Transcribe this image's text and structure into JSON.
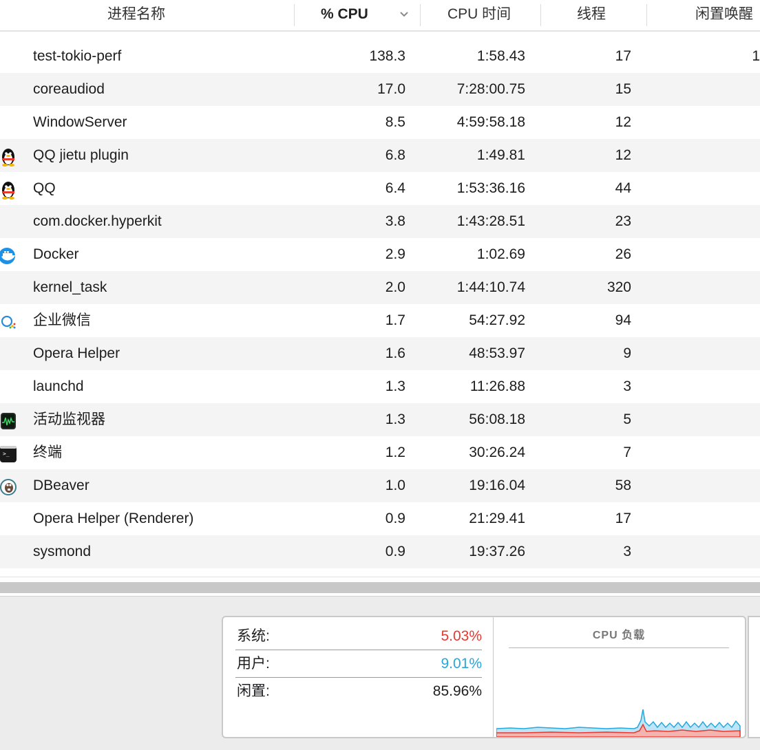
{
  "header": {
    "name": "进程名称",
    "cpu": "% CPU",
    "time": "CPU 时间",
    "threads": "线程",
    "wakeups": "闲置唤醒"
  },
  "rows": [
    {
      "name": "test-tokio-perf",
      "cpu": "138.3",
      "time": "1:58.43",
      "threads": "17",
      "wake": "1",
      "icon": "none"
    },
    {
      "name": "coreaudiod",
      "cpu": "17.0",
      "time": "7:28:00.75",
      "threads": "15",
      "wake": "",
      "icon": "none"
    },
    {
      "name": "WindowServer",
      "cpu": "8.5",
      "time": "4:59:58.18",
      "threads": "12",
      "wake": "",
      "icon": "none"
    },
    {
      "name": "QQ jietu plugin",
      "cpu": "6.8",
      "time": "1:49.81",
      "threads": "12",
      "wake": "",
      "icon": "qq-penguin-icon"
    },
    {
      "name": "QQ",
      "cpu": "6.4",
      "time": "1:53:36.16",
      "threads": "44",
      "wake": "",
      "icon": "qq-penguin-icon"
    },
    {
      "name": "com.docker.hyperkit",
      "cpu": "3.8",
      "time": "1:43:28.51",
      "threads": "23",
      "wake": "",
      "icon": "none"
    },
    {
      "name": "Docker",
      "cpu": "2.9",
      "time": "1:02.69",
      "threads": "26",
      "wake": "",
      "icon": "docker-whale-icon"
    },
    {
      "name": "kernel_task",
      "cpu": "2.0",
      "time": "1:44:10.74",
      "threads": "320",
      "wake": "",
      "icon": "none"
    },
    {
      "name": "企业微信",
      "cpu": "1.7",
      "time": "54:27.92",
      "threads": "94",
      "wake": "",
      "icon": "wecom-icon"
    },
    {
      "name": "Opera Helper",
      "cpu": "1.6",
      "time": "48:53.97",
      "threads": "9",
      "wake": "",
      "icon": "none"
    },
    {
      "name": "launchd",
      "cpu": "1.3",
      "time": "11:26.88",
      "threads": "3",
      "wake": "",
      "icon": "none"
    },
    {
      "name": "活动监视器",
      "cpu": "1.3",
      "time": "56:08.18",
      "threads": "5",
      "wake": "",
      "icon": "activity-monitor-icon"
    },
    {
      "name": "终端",
      "cpu": "1.2",
      "time": "30:26.24",
      "threads": "7",
      "wake": "",
      "icon": "terminal-icon"
    },
    {
      "name": "DBeaver",
      "cpu": "1.0",
      "time": "19:16.04",
      "threads": "58",
      "wake": "",
      "icon": "dbeaver-icon"
    },
    {
      "name": "Opera Helper (Renderer)",
      "cpu": "0.9",
      "time": "21:29.41",
      "threads": "17",
      "wake": "",
      "icon": "none"
    },
    {
      "name": "sysmond",
      "cpu": "0.9",
      "time": "19:37.26",
      "threads": "3",
      "wake": "",
      "icon": "none"
    }
  ],
  "stats": {
    "system_label": "系统:",
    "system_value": "5.03%",
    "user_label": "用户:",
    "user_value": "9.01%",
    "idle_label": "闲置:",
    "idle_value": "85.96%"
  },
  "chart": {
    "title": "CPU 负载"
  },
  "colors": {
    "system": "#e8382f",
    "user": "#24a8df"
  }
}
